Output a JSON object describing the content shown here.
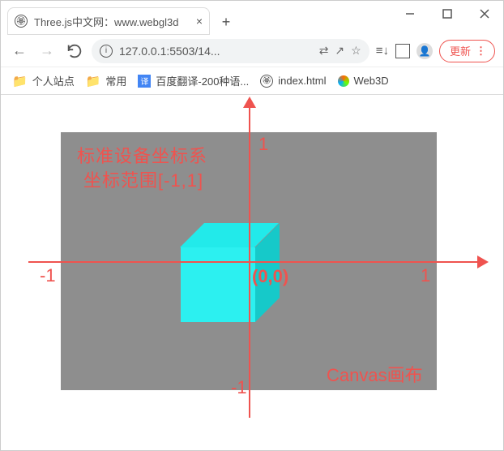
{
  "window": {
    "tab_title": "Three.js中文网：www.webgl3d",
    "tab_close": "×",
    "new_tab": "+"
  },
  "addressbar": {
    "back": "←",
    "forward": "→",
    "url": "127.0.0.1:5503/14...",
    "translate": "⇄",
    "share": "↗",
    "star": "☆",
    "readlist": "≡↓",
    "update_label": "更新",
    "update_dots": "⋮"
  },
  "bookmarks": {
    "b1": "个人站点",
    "b2": "常用",
    "b3_icon": "译",
    "b3": "百度翻译-200种语...",
    "b4": "index.html",
    "b5": "Web3D"
  },
  "diagram": {
    "desc1": "标准设备坐标系",
    "desc2": "坐标范围[-1,1]",
    "origin": "(0,0)",
    "yplus": "1",
    "yminus": "-1",
    "xplus": "1",
    "xminus": "-1",
    "canvastxt": "Canvas画布"
  }
}
